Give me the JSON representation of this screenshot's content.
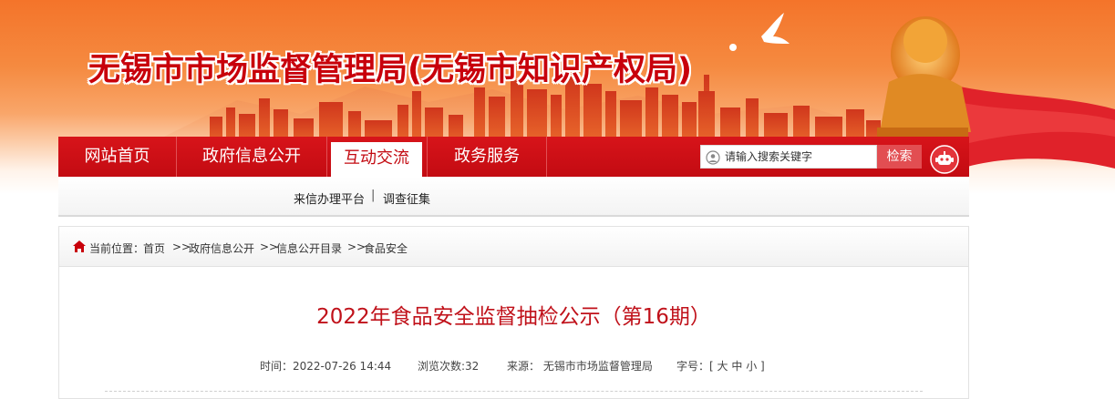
{
  "header": {
    "site_title": "无锡市市场监督管理局(无锡市知识产权局)"
  },
  "nav": {
    "items": [
      {
        "label": "网站首页",
        "active": false
      },
      {
        "label": "政府信息公开",
        "active": false
      },
      {
        "label": "互动交流",
        "active": true
      },
      {
        "label": "政务服务",
        "active": false
      }
    ],
    "search_placeholder": "请输入搜索关键字",
    "search_button": "检索",
    "robot_icon": "robot-icon"
  },
  "subnav": {
    "items": [
      "来信办理平台",
      "调查征集"
    ],
    "separator": "|"
  },
  "breadcrumb": {
    "prefix": "当前位置：",
    "items": [
      "首页",
      "政府信息公开",
      "信息公开目录",
      "食品安全"
    ],
    "separator": ">>"
  },
  "article": {
    "title": "2022年食品安全监督抽检公示（第16期）",
    "time": "时间：2022-07-26 14:44",
    "views": "浏览次数:32",
    "source": "来源： 无锡市市场监督管理局",
    "font_size_label": "字号：[",
    "font_sizes": [
      "大",
      "中",
      "小"
    ],
    "font_size_close": "]"
  },
  "colors": {
    "brand_red": "#c8000b",
    "nav_red": "#c30b12",
    "banner_orange": "#f4742a"
  }
}
